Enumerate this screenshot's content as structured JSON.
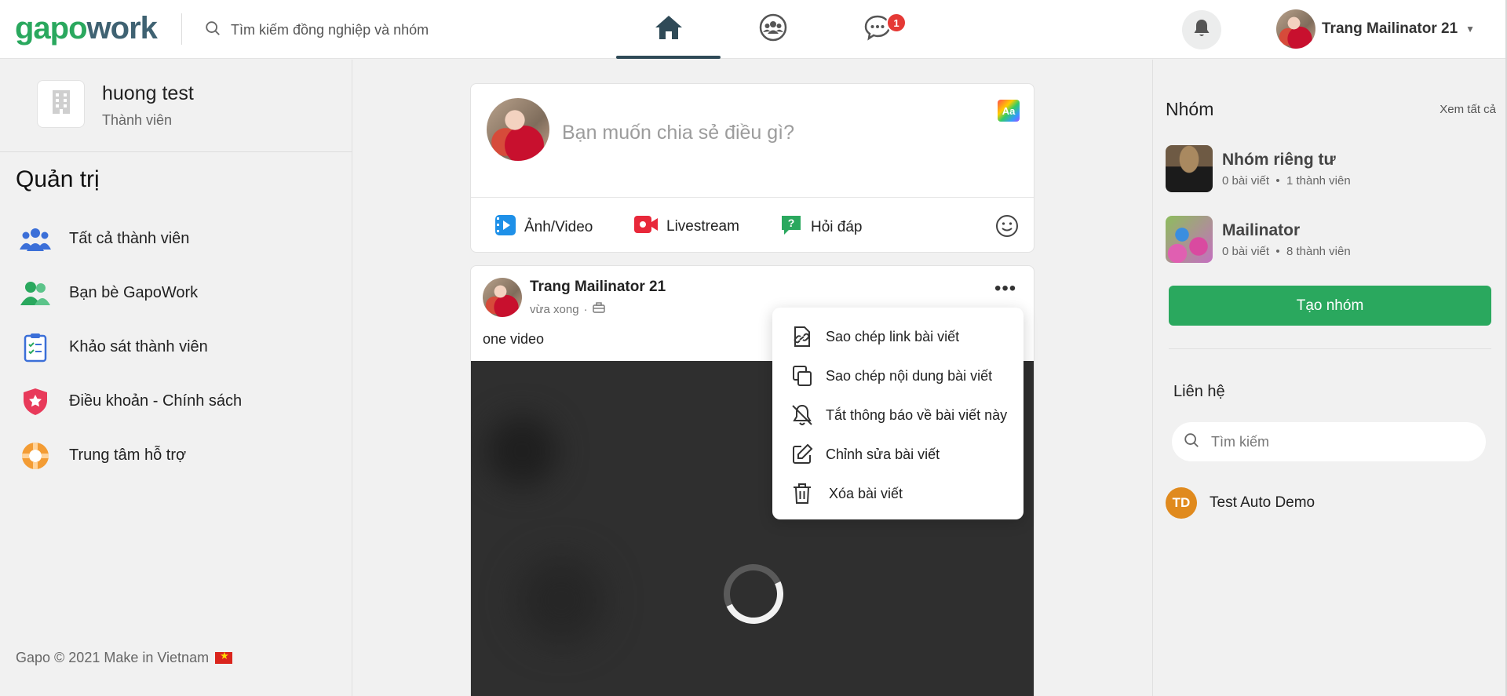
{
  "header": {
    "logo_part1": "gapo",
    "logo_part2": "work",
    "search_placeholder": "Tìm kiếm đồng nghiệp và nhóm",
    "chat_badge": "1",
    "user_name": "Trang Mailinator 21"
  },
  "left": {
    "org_name": "huong test",
    "org_role": "Thành viên",
    "admin_title": "Quản trị",
    "menu": [
      {
        "label": "Tất cả thành viên",
        "icon": "members-icon"
      },
      {
        "label": "Bạn bè GapoWork",
        "icon": "friends-icon"
      },
      {
        "label": "Khảo sát thành viên",
        "icon": "survey-icon"
      },
      {
        "label": "Điều khoản - Chính sách",
        "icon": "policy-shield-icon"
      },
      {
        "label": "Trung tâm hỗ trợ",
        "icon": "support-lifebuoy-icon"
      }
    ],
    "copyright": "Gapo © 2021 Make in Vietnam"
  },
  "composer": {
    "placeholder": "Bạn muốn chia sẻ điều gì?",
    "font_button": "Aa",
    "actions": [
      {
        "label": "Ảnh/Video"
      },
      {
        "label": "Livestream"
      },
      {
        "label": "Hỏi đáp"
      }
    ]
  },
  "post": {
    "author": "Trang Mailinator 21",
    "time": "vừa xong",
    "body": "one video"
  },
  "context_menu": {
    "items": [
      {
        "label": "Sao chép link bài viết",
        "icon": "copy-link-icon"
      },
      {
        "label": "Sao chép nội dung bài viết",
        "icon": "copy-content-icon"
      },
      {
        "label": "Tắt thông báo về bài viết này",
        "icon": "bell-off-icon"
      },
      {
        "label": "Chỉnh sửa bài viết",
        "icon": "edit-icon"
      },
      {
        "label": "Xóa bài viết",
        "icon": "trash-icon"
      }
    ]
  },
  "right": {
    "groups_title": "Nhóm",
    "see_all": "Xem tất cả",
    "groups": [
      {
        "name": "Nhóm riêng tư",
        "posts": "0 bài viết",
        "members": "1 thành viên"
      },
      {
        "name": "Mailinator",
        "posts": "0 bài viết",
        "members": "8 thành viên"
      }
    ],
    "create_group": "Tạo nhóm",
    "contacts_title": "Liên hệ",
    "contact_search_placeholder": "Tìm kiếm",
    "contacts": [
      {
        "initials": "TD",
        "name": "Test Auto Demo"
      }
    ]
  },
  "colors": {
    "brand_green": "#2aa85e",
    "brand_dark": "#3f6272",
    "badge_red": "#e53935"
  }
}
